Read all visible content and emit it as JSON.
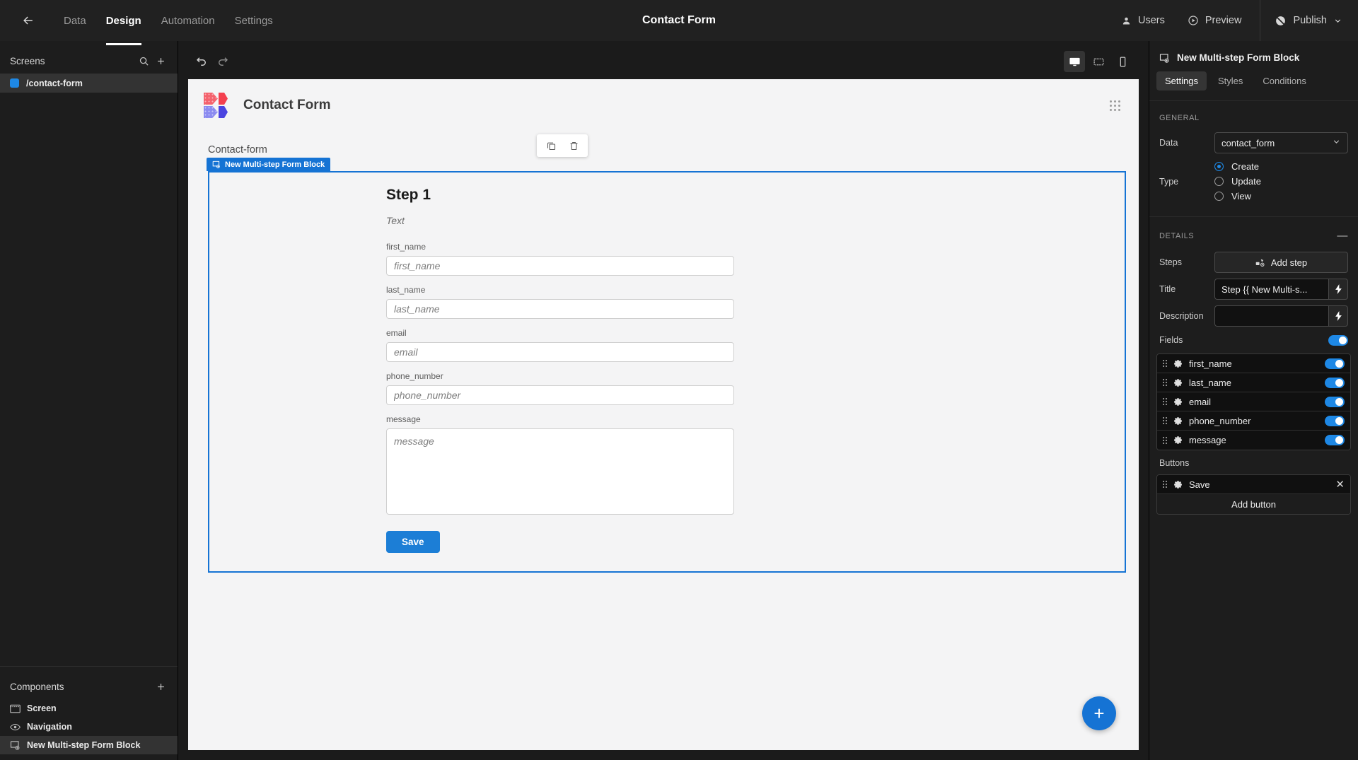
{
  "topbar": {
    "back_icon": "arrow-left-icon",
    "nav": [
      {
        "label": "Data",
        "active": false
      },
      {
        "label": "Design",
        "active": true
      },
      {
        "label": "Automation",
        "active": false
      },
      {
        "label": "Settings",
        "active": false
      }
    ],
    "title": "Contact Form",
    "users_label": "Users",
    "preview_label": "Preview",
    "publish_label": "Publish"
  },
  "left_panel": {
    "screens_title": "Screens",
    "screens": [
      {
        "label": "/contact-form",
        "selected": true
      }
    ],
    "components_title": "Components",
    "components": [
      {
        "label": "Screen",
        "icon": "screen-icon",
        "selected": false
      },
      {
        "label": "Navigation",
        "icon": "eye-icon",
        "selected": false
      },
      {
        "label": "New Multi-step Form Block",
        "icon": "form-block-icon",
        "selected": true
      }
    ]
  },
  "canvas": {
    "undo_icon": "undo-icon",
    "redo_icon": "redo-icon",
    "devices": [
      {
        "name": "desktop-view",
        "active": true
      },
      {
        "name": "tablet-view",
        "active": false
      },
      {
        "name": "mobile-view",
        "active": false
      }
    ],
    "preview_title": "Contact Form",
    "breadcrumb": "Contact-form",
    "float_actions": [
      {
        "name": "duplicate-block-button",
        "icon": "copy-icon"
      },
      {
        "name": "delete-block-button",
        "icon": "trash-icon"
      }
    ],
    "block_tag": "New Multi-step Form Block",
    "step_title": "Step 1",
    "step_description": "Text",
    "fields": [
      {
        "label": "first_name",
        "placeholder": "first_name",
        "type": "input"
      },
      {
        "label": "last_name",
        "placeholder": "last_name",
        "type": "input"
      },
      {
        "label": "email",
        "placeholder": "email",
        "type": "input"
      },
      {
        "label": "phone_number",
        "placeholder": "phone_number",
        "type": "input"
      },
      {
        "label": "message",
        "placeholder": "message",
        "type": "textarea"
      }
    ],
    "save_label": "Save",
    "fab_label": "+"
  },
  "right_panel": {
    "header_title": "New Multi-step Form Block",
    "tabs": [
      {
        "label": "Settings",
        "active": true
      },
      {
        "label": "Styles",
        "active": false
      },
      {
        "label": "Conditions",
        "active": false
      }
    ],
    "general": {
      "section_title": "GENERAL",
      "data_label": "Data",
      "data_value": "contact_form",
      "type_label": "Type",
      "type_options": [
        {
          "label": "Create",
          "selected": true
        },
        {
          "label": "Update",
          "selected": false
        },
        {
          "label": "View",
          "selected": false
        }
      ]
    },
    "details": {
      "section_title": "DETAILS",
      "collapse_icon": "minus-icon",
      "steps_label": "Steps",
      "add_step_label": "Add step",
      "title_label": "Title",
      "title_value": "Step {{ New Multi-s...",
      "description_label": "Description",
      "description_value": "",
      "fields_label": "Fields",
      "fields_enabled": true,
      "fields": [
        {
          "label": "first_name",
          "enabled": true
        },
        {
          "label": "last_name",
          "enabled": true
        },
        {
          "label": "email",
          "enabled": true
        },
        {
          "label": "phone_number",
          "enabled": true
        },
        {
          "label": "message",
          "enabled": true
        }
      ],
      "buttons_label": "Buttons",
      "buttons": [
        {
          "label": "Save"
        }
      ],
      "add_button_label": "Add button"
    }
  },
  "colors": {
    "accent": "#1573d4",
    "toggle_on": "#1e88e5",
    "save_button": "#1c7ed6"
  }
}
